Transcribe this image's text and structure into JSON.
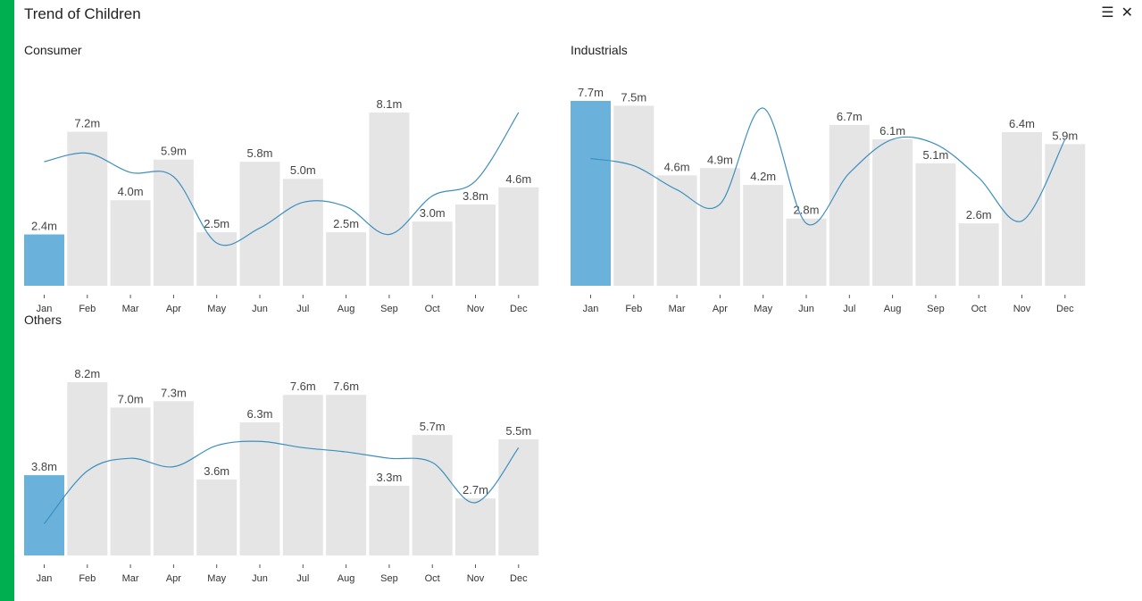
{
  "window": {
    "title": "Trend of Children",
    "menu_icon": "hamburger-menu-icon",
    "close_icon": "close-icon"
  },
  "colors": {
    "accent": "#00b050",
    "bar": "#e5e5e5",
    "highlight_bar": "#6ab2dc",
    "trend_line": "#3d8fbf"
  },
  "chart_data": [
    {
      "type": "bar",
      "title": "Consumer",
      "categories": [
        "Jan",
        "Feb",
        "Mar",
        "Apr",
        "May",
        "Jun",
        "Jul",
        "Aug",
        "Sep",
        "Oct",
        "Nov",
        "Dec"
      ],
      "values": [
        2.4,
        7.2,
        4.0,
        5.9,
        2.5,
        5.8,
        5.0,
        2.5,
        8.1,
        3.0,
        3.8,
        4.6
      ],
      "labels": [
        "2.4m",
        "7.2m",
        "4.0m",
        "5.9m",
        "2.5m",
        "5.8m",
        "5.0m",
        "2.5m",
        "8.1m",
        "3.0m",
        "3.8m",
        "4.6m"
      ],
      "highlight_index": 0,
      "trend": [
        5.8,
        6.2,
        5.3,
        5.1,
        2.0,
        2.7,
        3.9,
        3.7,
        2.4,
        4.2,
        4.9,
        8.1
      ],
      "ylim": [
        0,
        8.1
      ]
    },
    {
      "type": "bar",
      "title": "Industrials",
      "categories": [
        "Jan",
        "Feb",
        "Mar",
        "Apr",
        "May",
        "Jun",
        "Jul",
        "Aug",
        "Sep",
        "Oct",
        "Nov",
        "Dec"
      ],
      "values": [
        7.7,
        7.5,
        4.6,
        4.9,
        4.2,
        2.8,
        6.7,
        6.1,
        5.1,
        2.6,
        6.4,
        5.9
      ],
      "labels": [
        "7.7m",
        "7.5m",
        "4.6m",
        "4.9m",
        "4.2m",
        "2.8m",
        "6.7m",
        "6.1m",
        "5.1m",
        "2.6m",
        "6.4m",
        "5.9m"
      ],
      "highlight_index": 0,
      "trend": [
        5.3,
        5.0,
        4.0,
        3.4,
        7.4,
        2.6,
        4.7,
        6.1,
        5.9,
        4.5,
        2.7,
        6.1
      ],
      "ylim": [
        0,
        7.7
      ]
    },
    {
      "type": "bar",
      "title": "Others",
      "categories": [
        "Jan",
        "Feb",
        "Mar",
        "Apr",
        "May",
        "Jun",
        "Jul",
        "Aug",
        "Sep",
        "Oct",
        "Nov",
        "Dec"
      ],
      "values": [
        3.8,
        8.2,
        7.0,
        7.3,
        3.6,
        6.3,
        7.6,
        7.6,
        3.3,
        5.7,
        2.7,
        5.5
      ],
      "labels": [
        "3.8m",
        "8.2m",
        "7.0m",
        "7.3m",
        "3.6m",
        "6.3m",
        "7.6m",
        "7.6m",
        "3.3m",
        "5.7m",
        "2.7m",
        "5.5m"
      ],
      "highlight_index": 0,
      "trend": [
        1.5,
        4.0,
        4.6,
        4.2,
        5.2,
        5.4,
        5.1,
        4.9,
        4.6,
        4.4,
        2.5,
        5.1
      ],
      "ylim": [
        0,
        8.2
      ]
    }
  ]
}
